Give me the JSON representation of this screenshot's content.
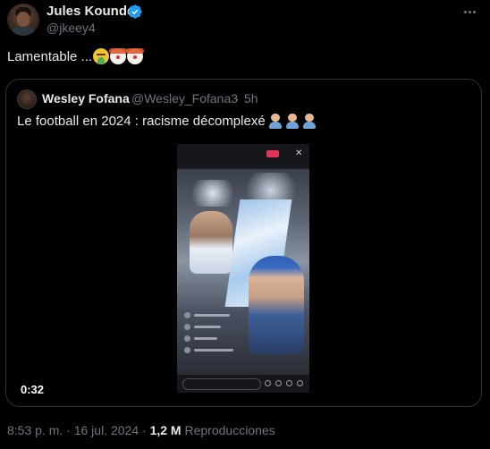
{
  "tweet": {
    "author_name": "Jules Kounde",
    "author_handle": "@jkeey4",
    "text": "Lamentable ...",
    "emojis": [
      "nauseated-face",
      "clown-face",
      "clown-face"
    ],
    "posted_time": "8:53 p. m.",
    "separator": "·",
    "posted_date": "16 jul. 2024",
    "view_count": "1,2 M",
    "view_label": "Reproducciones"
  },
  "quote": {
    "author_name": "Wesley Fofana",
    "author_handle": "@Wesley_Fofana3",
    "separator": "·",
    "time_ago": "5h",
    "text": "Le football en 2024 : racisme décomplexé",
    "emojis": [
      "person-raising-hand",
      "person-raising-hand",
      "person-raising-hand"
    ],
    "video_duration": "0:32"
  },
  "colors": {
    "background": "#000000",
    "text_primary": "#e7e9ea",
    "text_secondary": "#71767b",
    "verified_blue": "#1d9bf0",
    "border": "#2f3336"
  }
}
